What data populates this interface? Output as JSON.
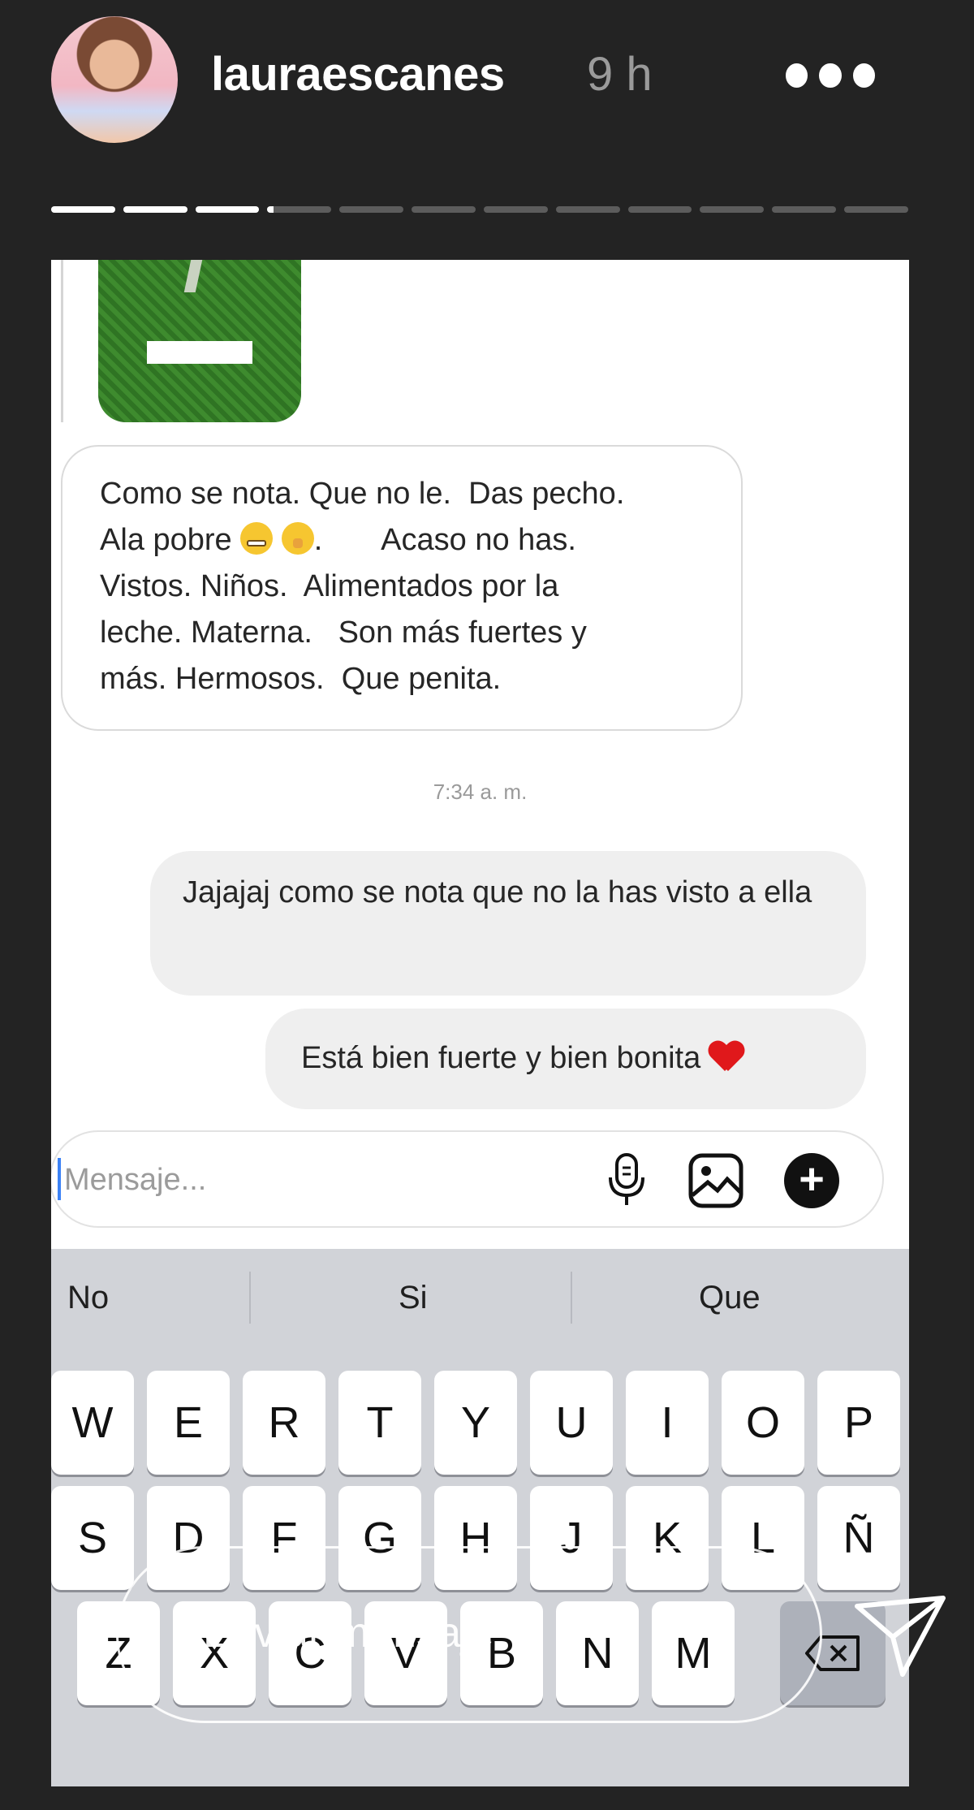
{
  "header": {
    "username": "lauraescanes",
    "time": "9 h",
    "more_icon": "more-horizontal-icon"
  },
  "story_progress": {
    "total": 12,
    "current_index": 3,
    "current_fraction": 0.1
  },
  "chat": {
    "received_text_part1": "Como se nota. Que no le.  Das pecho.\nAla pobre ",
    "received_text_part2": ".       Acaso no has.\nVistos. Niños.  Alimentados por la\nleche. Materna.   Son más fuertes y\nmás. Hermosos.  Que penita.",
    "timestamp": "7:34 a. m.",
    "sent_1": "Jajajaj como se nota que no la has visto a ella",
    "sent_2": "Está bien fuerte y bien bonita"
  },
  "composer": {
    "placeholder": "Mensaje..."
  },
  "keyboard": {
    "suggestions": [
      "No",
      "Si",
      "Que"
    ],
    "row1": [
      "W",
      "E",
      "R",
      "T",
      "Y",
      "U",
      "I",
      "O",
      "P"
    ],
    "row2": [
      "S",
      "D",
      "F",
      "G",
      "H",
      "J",
      "K",
      "L",
      "Ñ"
    ],
    "row3": [
      "Z",
      "X",
      "C",
      "V",
      "B",
      "N",
      "M"
    ]
  },
  "reply": {
    "placeholder": "Enviar mensaje"
  }
}
